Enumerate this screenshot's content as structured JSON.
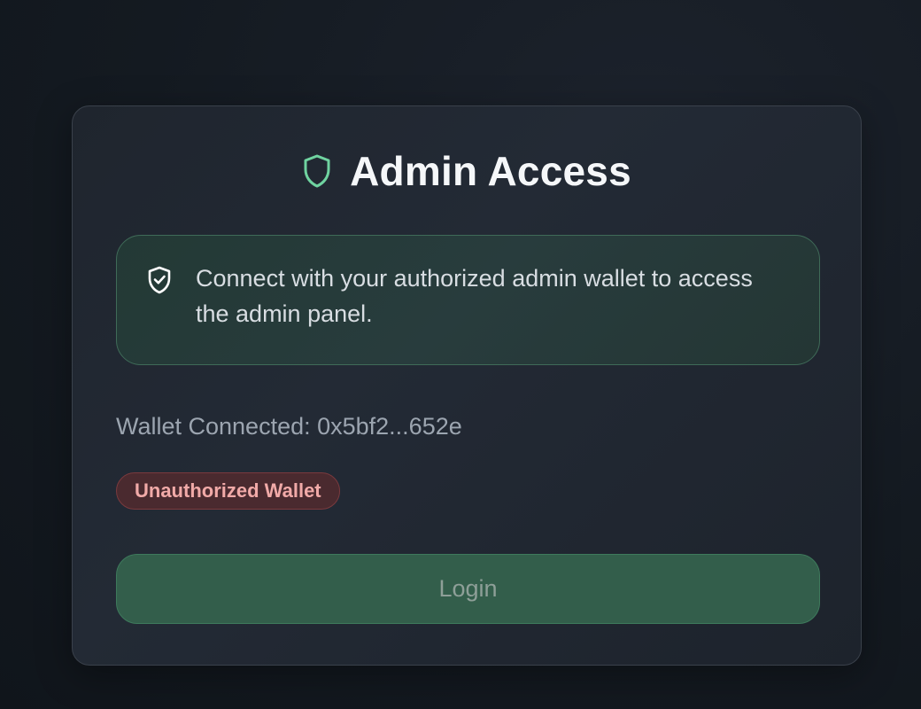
{
  "card": {
    "title": "Admin Access",
    "title_icon": "shield-icon",
    "info": {
      "icon": "shield-check-icon",
      "message": "Connect with your authorized admin wallet to access the admin panel."
    },
    "wallet_status": "Wallet Connected: 0x5bf2...652e",
    "badge": "Unauthorized Wallet",
    "login_label": "Login"
  },
  "colors": {
    "accent_green": "#6fd3a0",
    "danger_text": "#f1aaa8",
    "danger_bg": "#4a2a2f",
    "button_bg": "#335e4b"
  }
}
